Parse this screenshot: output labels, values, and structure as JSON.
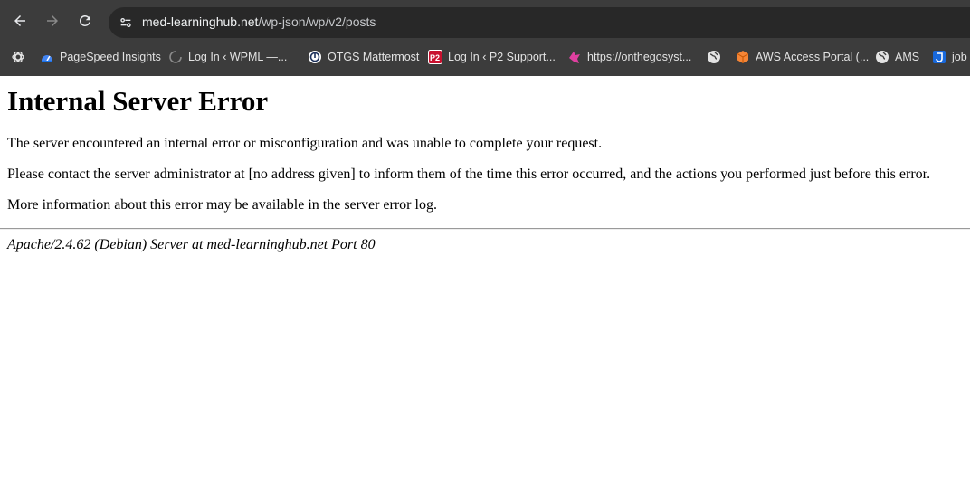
{
  "browser": {
    "url_host": "med-learninghub.net",
    "url_path": "/wp-json/wp/v2/posts",
    "nav": {
      "back_icon": "back-arrow-icon",
      "forward_icon": "forward-arrow-icon",
      "reload_icon": "reload-icon"
    }
  },
  "bookmarks": [
    {
      "label": "",
      "icon": "openai-icon"
    },
    {
      "label": "PageSpeed Insights",
      "icon": "pagespeed-icon"
    },
    {
      "label": "Log In ‹ WPML —...",
      "icon": "loading-icon"
    },
    {
      "label": "OTGS Mattermost",
      "icon": "mattermost-icon"
    },
    {
      "label": "Log In ‹ P2 Support...",
      "icon": "p2-icon"
    },
    {
      "label": "https://onthegosyst...",
      "icon": "pink-bird-icon"
    },
    {
      "label": "",
      "icon": "globe-icon"
    },
    {
      "label": "AWS Access Portal (...",
      "icon": "aws-cube-icon"
    },
    {
      "label": "AMS",
      "icon": "globe-icon"
    },
    {
      "label": "job",
      "icon": "jira-icon"
    }
  ],
  "page": {
    "title": "Internal Server Error",
    "paragraphs": [
      "The server encountered an internal error or misconfiguration and was unable to complete your request.",
      "Please contact the server administrator at [no address given] to inform them of the time this error occurred, and the actions you performed just before this error.",
      "More information about this error may be available in the server error log."
    ],
    "address": "Apache/2.4.62 (Debian) Server at med-learninghub.net Port 80"
  }
}
